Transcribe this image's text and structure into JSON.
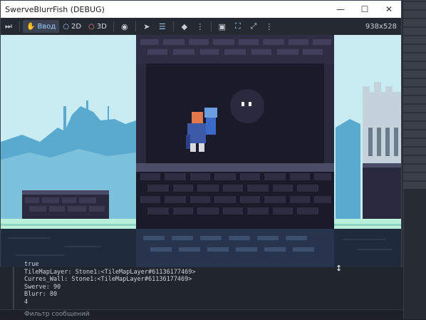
{
  "window": {
    "title": "SwerveBlurrFish (DEBUG)",
    "minimize_glyph": "—",
    "maximize_glyph": "☐",
    "close_glyph": "✕"
  },
  "toolbar": {
    "input_label": "Ввод",
    "mode_2d": "2D",
    "mode_3d": "3D",
    "resolution": "938x528"
  },
  "console": {
    "lines": [
      "true",
      "TileMapLayer: Stone1:<TileMapLayer#61136177469>",
      "Curres_Wall: Stone1:<TileMapLayer#61136177469>",
      "Swerve: 90",
      "Blurr: 80",
      "4"
    ],
    "filter_placeholder": "Фильтр сообщений"
  },
  "colors": {
    "sky": "#c9ecf2",
    "silhouette": "#5aa9cf",
    "stone_dark": "#2a2a3e",
    "stone_light": "#4a4c66",
    "water": "#1f2a3a",
    "grass": "#b8f0dc"
  }
}
